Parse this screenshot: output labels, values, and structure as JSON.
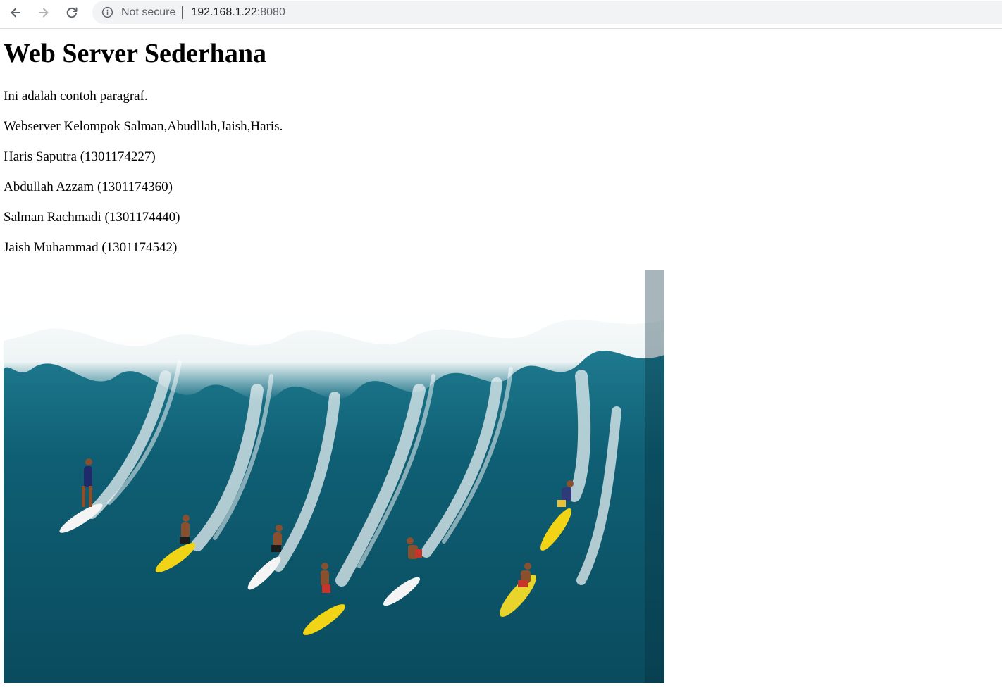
{
  "browser": {
    "security_label": "Not secure",
    "url_host": "192.168.1.22",
    "url_port": ":8080",
    "icons": {
      "back": "arrow-left-icon",
      "forward": "arrow-right-icon",
      "reload": "reload-icon",
      "info": "info-circle-icon"
    }
  },
  "page": {
    "heading": "Web Server Sederhana",
    "paragraphs": [
      "Ini adalah contoh paragraf.",
      "Webserver Kelompok Salman,Abudllah,Jaish,Haris.",
      "Haris Saputra (1301174227)",
      "Abdullah Azzam (1301174360)",
      "Salman Rachmadi (1301174440)",
      "Jaish Muhammad (1301174542)"
    ]
  },
  "colors": {
    "ocean_dark": "#0b4a5e",
    "ocean_mid": "#1d7f95",
    "foam": "#f2f6f7",
    "board_yellow": "#f2d417",
    "board_white": "#f4f4f4"
  }
}
